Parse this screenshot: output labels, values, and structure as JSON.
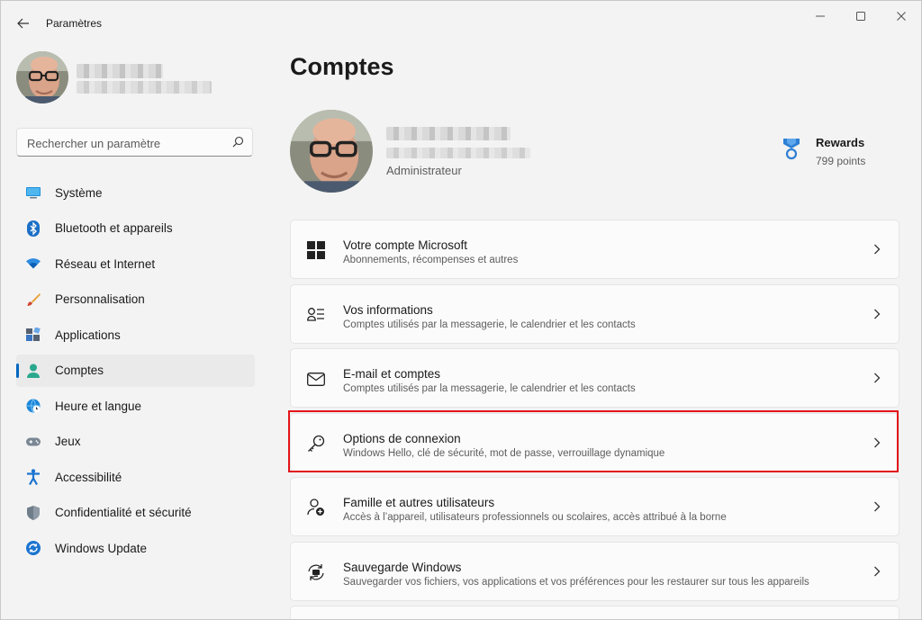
{
  "window": {
    "app_title": "Paramètres"
  },
  "sidebar": {
    "search": {
      "placeholder": "Rechercher un paramètre",
      "value": ""
    },
    "items": [
      {
        "label": "Système",
        "icon": "monitor-icon",
        "active": false
      },
      {
        "label": "Bluetooth et appareils",
        "icon": "bluetooth-icon",
        "active": false
      },
      {
        "label": "Réseau et Internet",
        "icon": "wifi-icon",
        "active": false
      },
      {
        "label": "Personnalisation",
        "icon": "brush-icon",
        "active": false
      },
      {
        "label": "Applications",
        "icon": "apps-icon",
        "active": false
      },
      {
        "label": "Comptes",
        "icon": "person-icon",
        "active": true
      },
      {
        "label": "Heure et langue",
        "icon": "globe-clock-icon",
        "active": false
      },
      {
        "label": "Jeux",
        "icon": "gamepad-icon",
        "active": false
      },
      {
        "label": "Accessibilité",
        "icon": "accessibility-icon",
        "active": false
      },
      {
        "label": "Confidentialité et sécurité",
        "icon": "shield-icon",
        "active": false
      },
      {
        "label": "Windows Update",
        "icon": "update-icon",
        "active": false
      }
    ]
  },
  "main": {
    "page_title": "Comptes",
    "account": {
      "role": "Administrateur"
    },
    "rewards": {
      "title": "Rewards",
      "points": "799 points",
      "icon": "medal-icon"
    },
    "cards": [
      {
        "title": "Votre compte Microsoft",
        "subtitle": "Abonnements, récompenses et autres",
        "icon": "windows-logo-icon"
      },
      {
        "title": "Vos informations",
        "subtitle": "Comptes utilisés par la messagerie, le calendrier et les contacts",
        "icon": "person-card-icon"
      },
      {
        "title": "E-mail et comptes",
        "subtitle": "Comptes utilisés par la messagerie, le calendrier et les contacts",
        "icon": "mail-icon"
      },
      {
        "title": "Options de connexion",
        "subtitle": "Windows Hello, clé de sécurité, mot de passe, verrouillage dynamique",
        "icon": "key-icon"
      },
      {
        "title": "Famille et autres utilisateurs",
        "subtitle": "Accès à l’appareil, utilisateurs professionnels ou scolaires, accès attribué à la borne",
        "icon": "person-add-icon"
      },
      {
        "title": "Sauvegarde Windows",
        "subtitle": "Sauvegarder vos fichiers, vos applications et vos préférences pour les restaurer sur tous les appareils",
        "icon": "backup-icon"
      }
    ]
  },
  "colors": {
    "accent": "#0067c0",
    "highlight_border": "#e3141b",
    "background": "#f3f3f3",
    "card": "#fbfbfb"
  }
}
